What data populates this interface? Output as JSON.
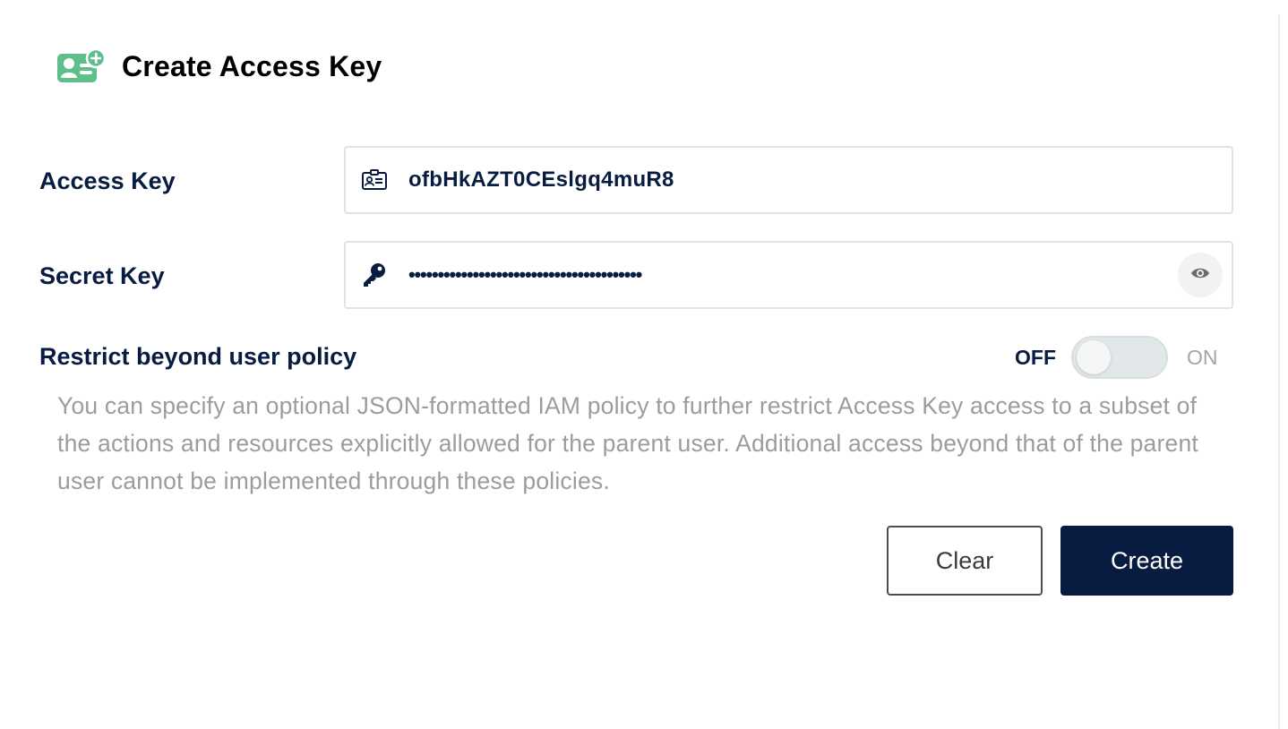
{
  "header": {
    "title": "Create Access Key",
    "icon": "add-access-key-icon",
    "icon_color": "#4caf77"
  },
  "form": {
    "access_key": {
      "label": "Access Key",
      "value": "ofbHkAZT0CEslgq4muR8",
      "icon": "id-card-icon"
    },
    "secret_key": {
      "label": "Secret Key",
      "masked_value": "••••••••••••••••••••••••••••••••••••••••",
      "icon": "key-icon",
      "toggle_visibility_icon": "eye-icon"
    },
    "restrict_policy": {
      "label": "Restrict beyond user policy",
      "off_label": "OFF",
      "on_label": "ON",
      "enabled": false,
      "description": "You can specify an optional JSON-formatted IAM policy to further restrict Access Key access to a subset of the actions and resources explicitly allowed for the parent user. Additional access beyond that of the parent user cannot be implemented through these policies."
    }
  },
  "actions": {
    "clear_label": "Clear",
    "create_label": "Create"
  },
  "colors": {
    "primary": "#081c42",
    "accent_green": "#4caf77",
    "muted_text": "#9c9c9c",
    "border": "#e2e2e2"
  }
}
